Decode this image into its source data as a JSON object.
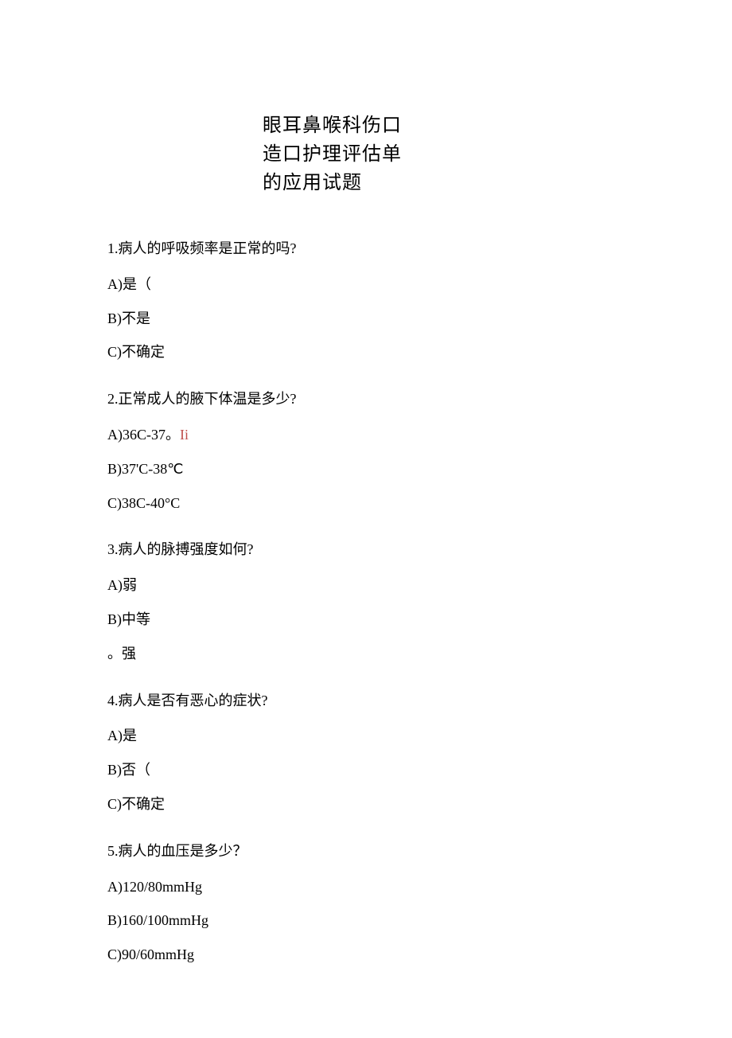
{
  "title": {
    "line1": "眼耳鼻喉科伤口",
    "line2": "造口护理评估单",
    "line3": "的应用试题"
  },
  "questions": [
    {
      "q": "1.病人的呼吸频率是正常的吗?",
      "options": [
        {
          "prefix": "A)",
          "text": "是（",
          "colored": ""
        },
        {
          "prefix": "B)",
          "text": "不是",
          "colored": ""
        },
        {
          "prefix": "C)",
          "text": "不确定",
          "colored": ""
        }
      ]
    },
    {
      "q": "2.正常成人的腋下体温是多少?",
      "options": [
        {
          "prefix": "A)",
          "text": "36C-37。",
          "colored": "Ii"
        },
        {
          "prefix": "B)",
          "text": "37'C-38℃",
          "colored": ""
        },
        {
          "prefix": "C)",
          "text": "38C-40°C",
          "colored": ""
        }
      ]
    },
    {
      "q": "3.病人的脉搏强度如何?",
      "options": [
        {
          "prefix": "A)",
          "text": "弱",
          "colored": ""
        },
        {
          "prefix": "B)",
          "text": "中等",
          "colored": ""
        },
        {
          "prefix": "。",
          "text": "强",
          "colored": ""
        }
      ]
    },
    {
      "q": "4.病人是否有恶心的症状?",
      "options": [
        {
          "prefix": "A)",
          "text": "是",
          "colored": ""
        },
        {
          "prefix": "B)",
          "text": "否（",
          "colored": ""
        },
        {
          "prefix": "C)",
          "text": "不确定",
          "colored": ""
        }
      ]
    },
    {
      "q": "5.病人的血压是多少？",
      "options": [
        {
          "prefix": "A)",
          "text": "120/80mmHg",
          "colored": ""
        },
        {
          "prefix": "B)",
          "text": "160/100mmHg",
          "colored": ""
        },
        {
          "prefix": "C)",
          "text": "90/60mmHg",
          "colored": ""
        }
      ]
    }
  ]
}
